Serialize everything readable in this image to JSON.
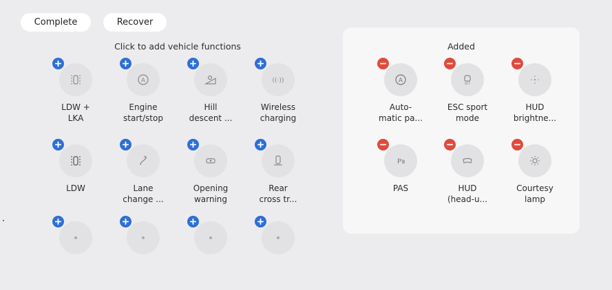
{
  "toolbar": {
    "complete_label": "Complete",
    "recover_label": "Recover"
  },
  "available": {
    "title": "Click to add vehicle functions",
    "items": [
      {
        "label": "LDW +\nLKA",
        "icon": "car-lanes-icon"
      },
      {
        "label": "Engine\nstart/stop",
        "icon": "auto-stop-icon"
      },
      {
        "label": "Hill\ndescent ...",
        "icon": "hill-descent-icon"
      },
      {
        "label": "Wireless\ncharging",
        "icon": "wireless-charging-icon"
      },
      {
        "label": "LDW",
        "icon": "car-lane-departure-icon"
      },
      {
        "label": "Lane\nchange ...",
        "icon": "lane-change-icon"
      },
      {
        "label": "Opening\nwarning",
        "icon": "door-open-warning-icon"
      },
      {
        "label": "Rear\ncross tr...",
        "icon": "rear-cross-traffic-icon"
      },
      {
        "label": "",
        "icon": "function-icon"
      },
      {
        "label": "",
        "icon": "function-icon"
      },
      {
        "label": "",
        "icon": "function-icon"
      },
      {
        "label": "",
        "icon": "function-icon"
      }
    ]
  },
  "added": {
    "title": "Added",
    "items": [
      {
        "label": "Auto-\nmatic pa...",
        "icon": "auto-hold-icon"
      },
      {
        "label": "ESC sport\nmode",
        "icon": "esc-off-icon"
      },
      {
        "label": "HUD\nbrightne...",
        "icon": "brightness-icon"
      },
      {
        "label": "PAS",
        "icon": "parking-assist-icon"
      },
      {
        "label": "HUD\n(head-u...",
        "icon": "hud-icon"
      },
      {
        "label": "Courtesy\nlamp",
        "icon": "courtesy-lamp-icon"
      }
    ]
  },
  "colors": {
    "add_badge": "#2d6fd6",
    "remove_badge": "#e04a3c",
    "background": "#ececee",
    "panel": "#f7f7f8"
  }
}
